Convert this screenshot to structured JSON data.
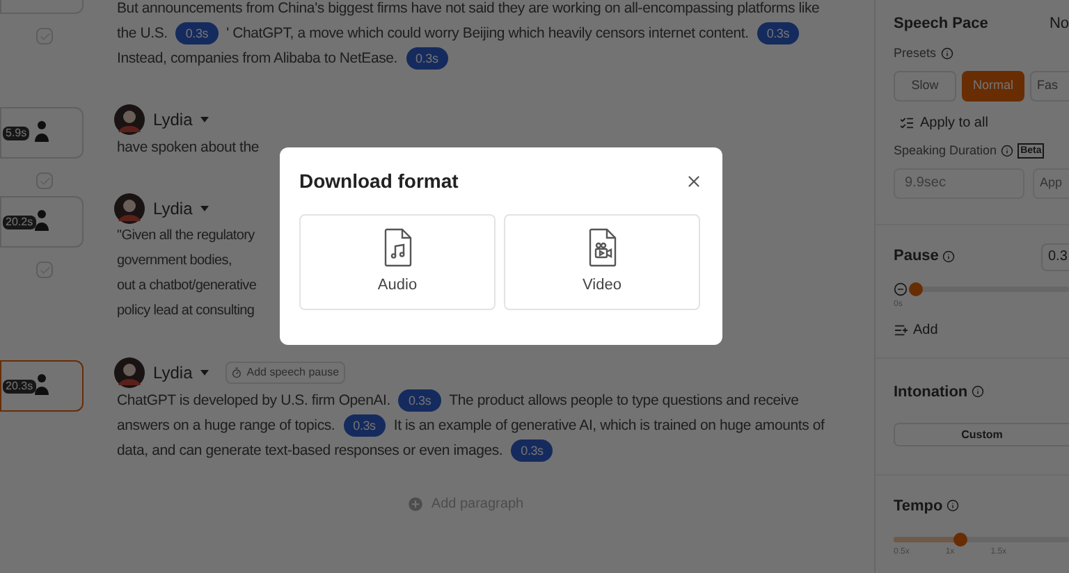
{
  "paragraphs": [
    {
      "kind": "flow",
      "checked": false,
      "thumbnail": {
        "selected": false
      },
      "segments": [
        {
          "kind": "text",
          "text": "But announcements from China's biggest firms have not said they are working on all-encompassing platforms like the U.S."
        },
        {
          "kind": "pause",
          "text": "0.3s"
        },
        {
          "kind": "text",
          "text": "' ChatGPT, a move which could worry Beijing which heavily censors internet content."
        },
        {
          "kind": "pause",
          "text": "0.3s"
        },
        {
          "kind": "text",
          "text": "Instead, companies from Alibaba to NetEase."
        },
        {
          "kind": "pause",
          "text": "0.3s"
        }
      ]
    },
    {
      "kind": "flow",
      "speaker": "Lydia",
      "checked": false,
      "thumbnail": {
        "duration": "5.9s",
        "selected": false
      },
      "segments": [
        {
          "kind": "text",
          "text": "have spoken about the"
        }
      ]
    },
    {
      "kind": "lines",
      "speaker": "Lydia",
      "checked": false,
      "thumbnail": {
        "duration": "20.2s",
        "selected": false
      },
      "lines": [
        "\"Given all the regulatory",
        "government bodies,",
        "out a chatbot/generative",
        "policy lead at consulting"
      ]
    },
    {
      "kind": "flow",
      "speaker": "Lydia",
      "speech_pause": "Add speech pause",
      "thumbnail": {
        "duration": "20.3s",
        "selected": true
      },
      "segments": [
        {
          "kind": "text",
          "text": "ChatGPT is developed by U.S. firm OpenAI."
        },
        {
          "kind": "pause",
          "text": "0.3s"
        },
        {
          "kind": "text",
          "text": "The product allows people to type questions and receive answers on a huge range of topics."
        },
        {
          "kind": "pause",
          "text": "0.3s"
        },
        {
          "kind": "text",
          "text": "It is an example of generative AI, which is trained on huge amounts of data, and can generate text-based responses or even images."
        },
        {
          "kind": "pause",
          "text": "0.3s"
        }
      ]
    }
  ],
  "add_paragraph": "Add paragraph",
  "panel": {
    "speech_pace": {
      "title": "Speech Pace",
      "value": "No",
      "presets_label": "Presets",
      "presets": [
        {
          "label": "Slow",
          "selected": false
        },
        {
          "label": "Normal",
          "selected": true
        },
        {
          "label": "Fas",
          "selected": false
        }
      ],
      "apply_all": "Apply to all",
      "duration_label": "Speaking Duration",
      "beta": "Beta",
      "duration_value": "9.9sec",
      "apply": "App"
    },
    "pause": {
      "title": "Pause",
      "value": "0.3",
      "level": 0.02,
      "min_label": "0s",
      "add": "Add"
    },
    "intonation": {
      "title": "Intonation",
      "option": "Custom"
    },
    "tempo": {
      "title": "Tempo",
      "level": 0.38,
      "ticks": [
        "0.5x",
        "1x",
        "1.5x"
      ]
    }
  },
  "dialog": {
    "title": "Download format",
    "options": [
      {
        "kind": "audio",
        "label": "Audio"
      },
      {
        "kind": "video",
        "label": "Video"
      }
    ]
  }
}
